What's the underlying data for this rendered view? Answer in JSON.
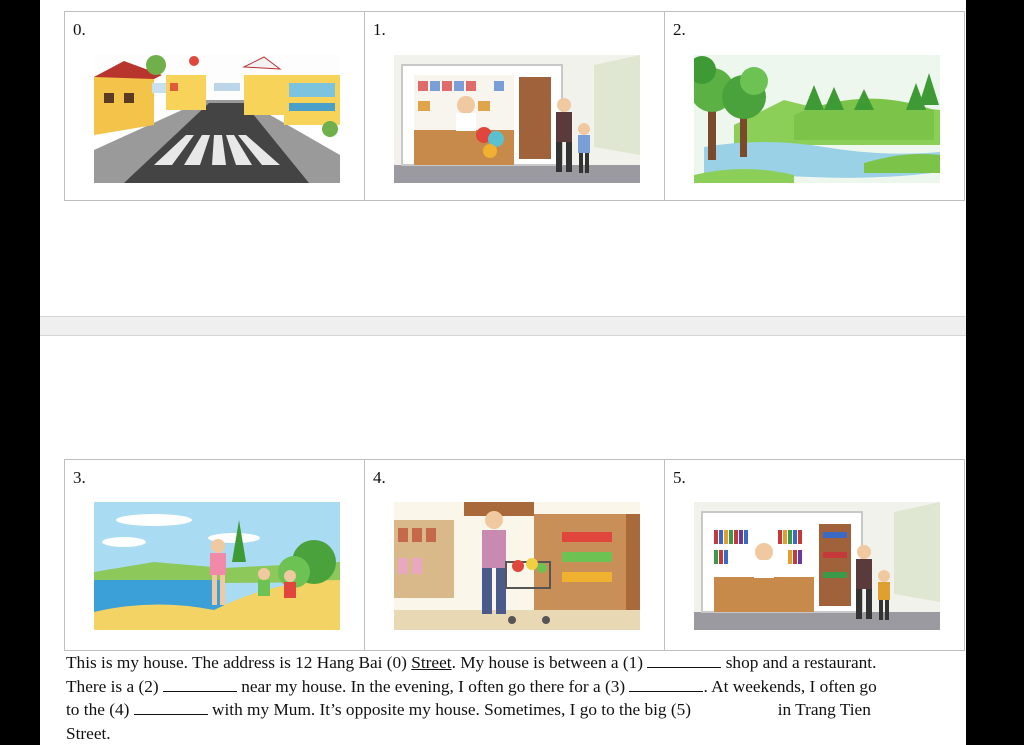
{
  "top_row": [
    {
      "num": "0.",
      "icon": "street-scene-icon"
    },
    {
      "num": "1.",
      "icon": "gift-shop-scene-icon"
    },
    {
      "num": "2.",
      "icon": "river-park-scene-icon"
    }
  ],
  "bottom_row": [
    {
      "num": "3.",
      "icon": "lake-walk-scene-icon"
    },
    {
      "num": "4.",
      "icon": "supermarket-scene-icon"
    },
    {
      "num": "5.",
      "icon": "bookshop-scene-icon"
    }
  ],
  "passage": {
    "s1": "This is my house. The address is 12 Hang Bai (0) ",
    "answer0": "Street",
    "s2": ". My house is between a (1) ",
    "s3": " shop and a restaurant. There is a (2) ",
    "s4": " near my house. In the evening, I often go there for a (3) ",
    "s5": ". At weekends, I often go to the (4) ",
    "s6": " with my Mum. It’s opposite my house. Sometimes, I go to the big (5) ",
    "s7": " in Trang Tien Street."
  }
}
